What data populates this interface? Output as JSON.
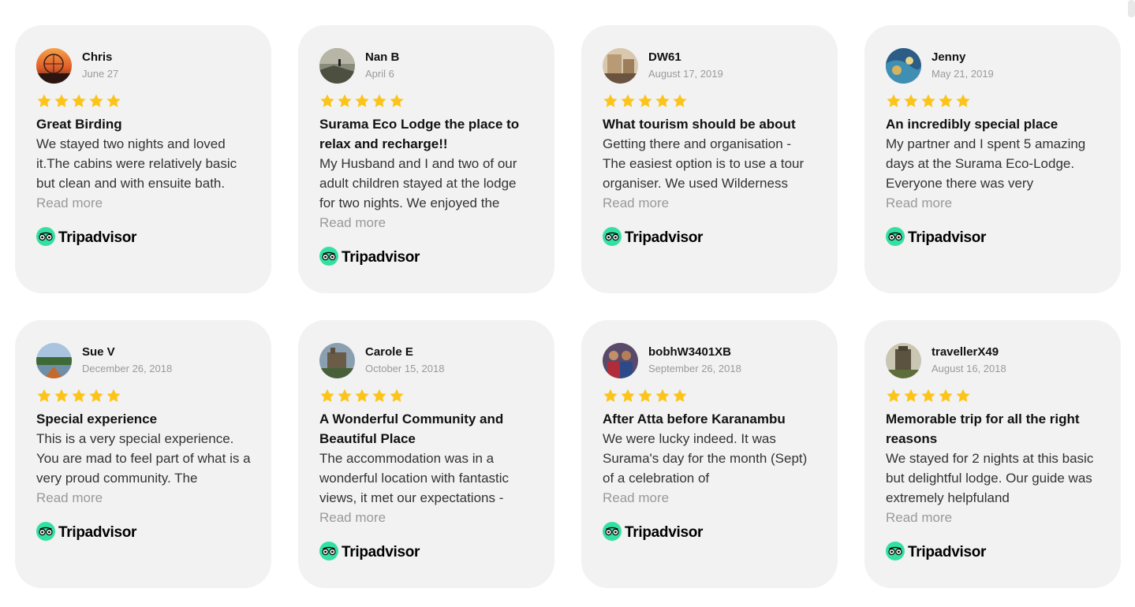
{
  "brand": {
    "name": "Tripadvisor",
    "color": "#34e0a1"
  },
  "star_color": "#fcc419",
  "reviews": [
    {
      "name": "Chris",
      "date": "June 27",
      "rating": 5,
      "title": "Great Birding",
      "text": "We stayed two nights and loved it.The cabins were relatively basic but clean and with ensuite bath.",
      "read_more": "Read more",
      "avatar": "sunset"
    },
    {
      "name": "Nan B",
      "date": "April 6",
      "rating": 5,
      "title": "Surama Eco Lodge the place to relax and recharge!!",
      "text": "My Husband and I and two of our adult children stayed at the lodge for two nights. We enjoyed the",
      "read_more": "Read more",
      "avatar": "hiker"
    },
    {
      "name": "DW61",
      "date": "August 17, 2019",
      "rating": 5,
      "title": "What tourism should be about",
      "text": "Getting there and organisation - The easiest option is to use a tour organiser. We used Wilderness",
      "read_more": "Read more",
      "avatar": "ruins"
    },
    {
      "name": "Jenny",
      "date": "May 21, 2019",
      "rating": 5,
      "title": "An incredibly special place",
      "text": "My partner and I spent 5 amazing days at the Surama Eco-Lodge. Everyone there was very",
      "read_more": "Read more",
      "avatar": "reef"
    },
    {
      "name": "Sue V",
      "date": "December 26, 2018",
      "rating": 5,
      "title": "Special experience",
      "text": "This is a very special experience. You are mad to feel part of what is a very proud community. The",
      "read_more": "Read more",
      "avatar": "river"
    },
    {
      "name": "Carole E",
      "date": "October 15, 2018",
      "rating": 5,
      "title": "A Wonderful Community and Beautiful Place",
      "text": "The accommodation was in a wonderful location with fantastic views, it met our expectations -",
      "read_more": "Read more",
      "avatar": "castle"
    },
    {
      "name": "bobhW3401XB",
      "date": "September 26, 2018",
      "rating": 5,
      "title": "After Atta before Karanambu",
      "text": "We were lucky indeed. It was Surama's day for the month (Sept) of a celebration of",
      "read_more": "Read more",
      "avatar": "people"
    },
    {
      "name": "travellerX49",
      "date": "August 16, 2018",
      "rating": 5,
      "title": "Memorable trip for all the right reasons",
      "text": "We stayed for 2 nights at this basic but delightful lodge. Our guide was extremely helpfuland",
      "read_more": "Read more",
      "avatar": "tower"
    }
  ]
}
